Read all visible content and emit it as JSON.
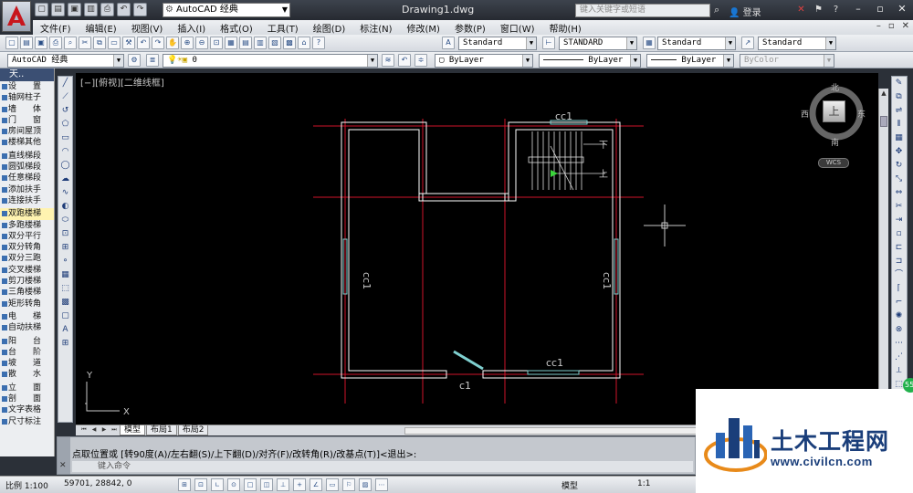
{
  "app": {
    "doc_title": "Drawing1.dwg",
    "workspace": "AutoCAD 经典",
    "search_placeholder": "键入关键字或短语",
    "login": "登录"
  },
  "menu": [
    "文件(F)",
    "编辑(E)",
    "视图(V)",
    "插入(I)",
    "格式(O)",
    "工具(T)",
    "绘图(D)",
    "标注(N)",
    "修改(M)",
    "参数(P)",
    "窗口(W)",
    "帮助(H)"
  ],
  "toolbar": {
    "text_style": "Standard",
    "dim_style": "STANDARD",
    "table_style": "Standard",
    "mleader_style": "Standard",
    "workspace2": "AutoCAD 经典",
    "layer": "0",
    "color": "ByLayer",
    "linetype": "ByLayer",
    "lineweight": "ByLayer",
    "plotstyle": "ByColor"
  },
  "palette": {
    "title": "天..",
    "items": [
      "设　　置",
      "轴网柱子",
      "墙　　体",
      "门　　窗",
      "房间屋顶",
      "楼梯其他",
      "直线梯段",
      "圆弧梯段",
      "任意梯段",
      "添加扶手",
      "连接扶手",
      "双跑楼梯",
      "多跑楼梯",
      "双分平行",
      "双分转角",
      "双分三跑",
      "交叉楼梯",
      "剪刀楼梯",
      "三角楼梯",
      "矩形转角",
      "电　　梯",
      "自动扶梯",
      "阳　　台",
      "台　　阶",
      "坡　　道",
      "散　　水",
      "立　　面",
      "剖　　面",
      "文字表格",
      "尺寸标注"
    ]
  },
  "viewport": {
    "label": "[−][俯视][二维线框]",
    "compass": {
      "n": "北",
      "s": "南",
      "e": "东",
      "w": "西",
      "cube": "上"
    },
    "wcs": "WCS",
    "labels": {
      "window_top": "cc1",
      "window_left": "cc1",
      "window_right": "cc1",
      "window_bottom": "cc1",
      "door": "c1",
      "stair_down": "下",
      "stair_up": "上"
    },
    "ucs_x": "X",
    "ucs_y": "Y"
  },
  "layout_tabs": [
    "模型",
    "布局1",
    "布局2"
  ],
  "command": {
    "history": "点取位置或 [转90度(A)/左右翻(S)/上下翻(D)/对齐(F)/改转角(R)/改基点(T)]<退出>:",
    "prompt": "键入命令"
  },
  "status": {
    "scale": "比例 1:100",
    "coords": "59701, 28842, 0",
    "model": "模型",
    "anno_scale": "1:1"
  },
  "watermark": {
    "title": "土木工程网",
    "url": "www.civilcn.com"
  },
  "colors": {
    "canvas": "#000000",
    "wall": "#ffffff",
    "axis": "#d0142a",
    "window": "#7fd0d0"
  }
}
